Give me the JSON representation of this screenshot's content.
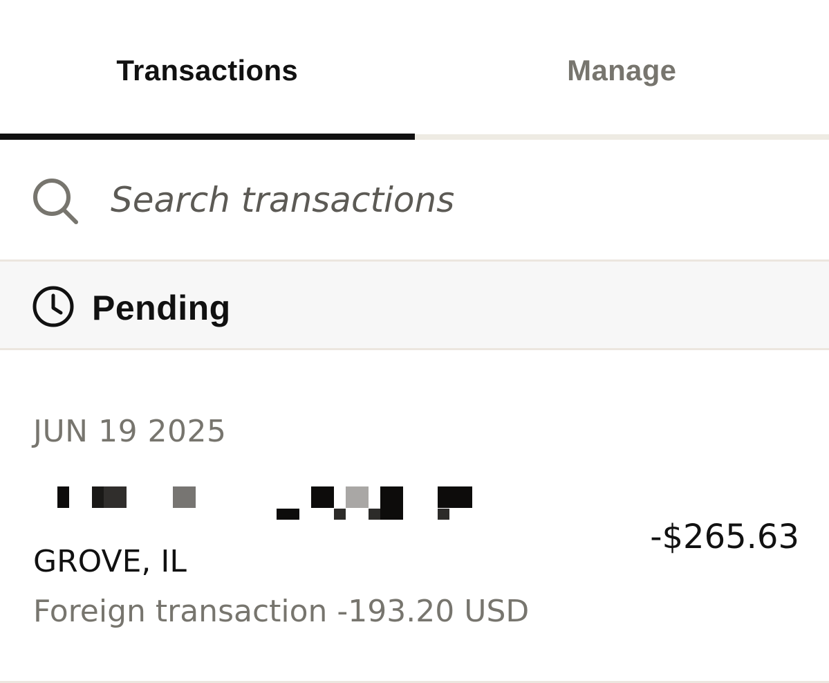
{
  "tabs": [
    {
      "label": "Transactions",
      "active": true
    },
    {
      "label": "Manage",
      "active": false
    }
  ],
  "search": {
    "placeholder": "Search transactions",
    "icon": "search-icon"
  },
  "section": {
    "title": "Pending",
    "icon": "clock-icon"
  },
  "transactions": [
    {
      "date": "JUN 19 2025",
      "merchant_redacted": true,
      "location": "GROVE, IL",
      "note": "Foreign transaction -193.20 USD",
      "amount": "-$265.63"
    }
  ],
  "colors": {
    "text_primary": "#111111",
    "text_secondary": "#77756e",
    "tab_inactive_underline": "#eeebe3",
    "section_bg": "#f7f7f7",
    "divider": "#ece6df"
  }
}
